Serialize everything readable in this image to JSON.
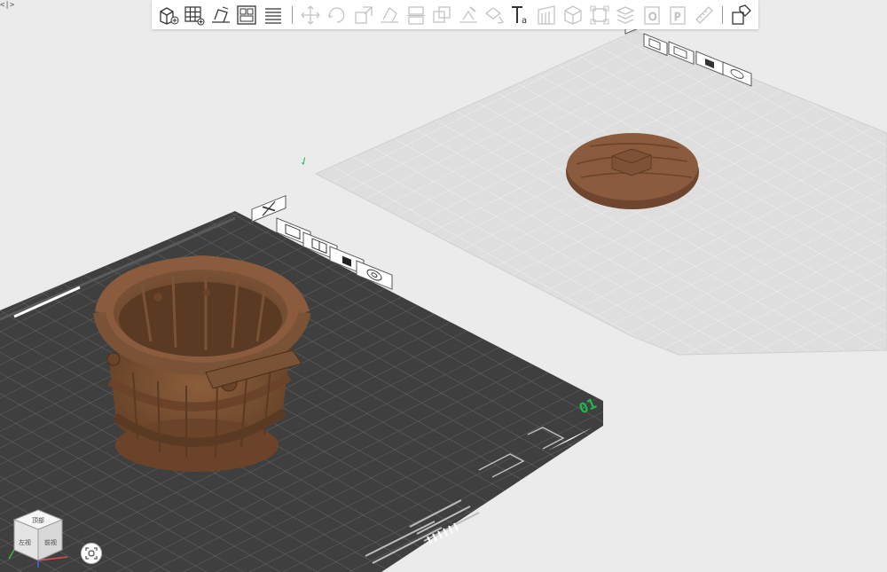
{
  "corner_toggle": "<|>",
  "toolbar": {
    "buttons": [
      {
        "name": "add-object-button",
        "icon": "add-cube-icon",
        "enabled": true
      },
      {
        "name": "add-plate-button",
        "icon": "add-plate-grid-icon",
        "enabled": true
      },
      {
        "name": "auto-orient-button",
        "icon": "orient-icon",
        "enabled": true
      },
      {
        "name": "arrange-button",
        "icon": "arrange-icon",
        "enabled": true
      },
      {
        "name": "layers-button",
        "icon": "layers-icon",
        "enabled": true
      },
      {
        "name": "move-button",
        "icon": "move-icon",
        "enabled": false
      },
      {
        "name": "rotate-button",
        "icon": "rotate-icon",
        "enabled": false
      },
      {
        "name": "scale-button",
        "icon": "scale-icon",
        "enabled": false
      },
      {
        "name": "lay-on-face-button",
        "icon": "lay-face-icon",
        "enabled": false
      },
      {
        "name": "cut-button",
        "icon": "cut-icon",
        "enabled": false
      },
      {
        "name": "boolean-button",
        "icon": "boolean-icon",
        "enabled": false
      },
      {
        "name": "support-paint-button",
        "icon": "support-paint-icon",
        "enabled": false
      },
      {
        "name": "seam-paint-button",
        "icon": "seam-paint-icon",
        "enabled": false
      },
      {
        "name": "text-button",
        "icon": "text-icon",
        "enabled": true
      },
      {
        "name": "variable-layer-button",
        "icon": "variable-layer-icon",
        "enabled": false
      },
      {
        "name": "hollow-button",
        "icon": "hollow-icon",
        "enabled": false
      },
      {
        "name": "bounding-box-button",
        "icon": "bounding-box-icon",
        "enabled": false
      },
      {
        "name": "split-objects-button",
        "icon": "split-objects-icon",
        "enabled": false
      },
      {
        "name": "split-parts-button",
        "icon": "split-parts-icon",
        "enabled": false
      },
      {
        "name": "plate-settings-button",
        "icon": "plate-settings-icon",
        "enabled": false
      },
      {
        "name": "measure-button",
        "icon": "measure-icon",
        "enabled": false
      },
      {
        "name": "assemble-button",
        "icon": "assemble-icon",
        "enabled": true
      }
    ]
  },
  "plates": [
    {
      "name": "plate-1",
      "label": "01",
      "selected": true,
      "bed_color": "#3f3f3f",
      "model": "wooden-bucket"
    },
    {
      "name": "plate-2",
      "label": "✓",
      "selected": false,
      "bed_color": "#dcdcdc",
      "model": "bucket-lid"
    }
  ],
  "plate_tools": [
    "close-plate-icon",
    "auto-orient-plate-icon",
    "arrange-plate-icon",
    "lock-plate-icon",
    "plate-settings-icon"
  ],
  "colors": {
    "background": "#ebebeb",
    "model": "#7a5236",
    "accent": "#1db954"
  },
  "viewcube": {
    "top": "顶部",
    "left": "左视",
    "front": "前视"
  }
}
